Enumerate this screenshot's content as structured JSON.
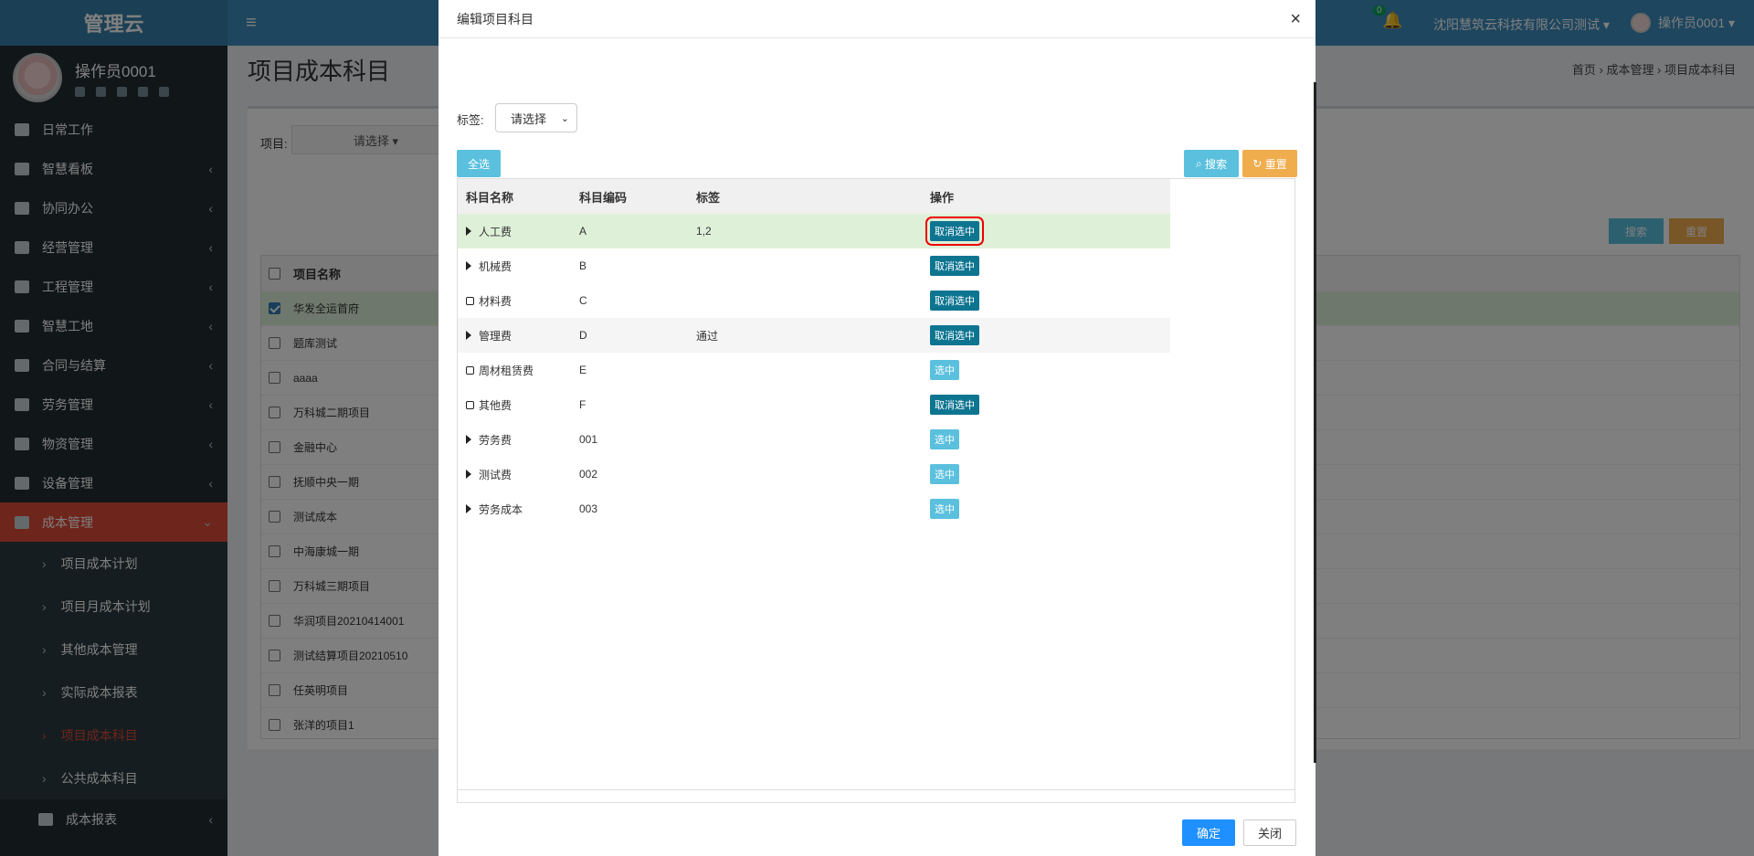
{
  "app": {
    "brand": "管理云"
  },
  "sidebar": {
    "user_name": "操作员0001",
    "menu": [
      {
        "label": "日常工作",
        "icon": "list-icon",
        "chevron": ""
      },
      {
        "label": "智慧看板",
        "icon": "dashboard-icon",
        "chevron": "‹"
      },
      {
        "label": "协同办公",
        "icon": "users-icon",
        "chevron": "‹"
      },
      {
        "label": "经营管理",
        "icon": "desktop-icon",
        "chevron": "‹"
      },
      {
        "label": "工程管理",
        "icon": "gavel-icon",
        "chevron": "‹"
      },
      {
        "label": "智慧工地",
        "icon": "monitor-icon",
        "chevron": "‹"
      },
      {
        "label": "合同与结算",
        "icon": "file-icon",
        "chevron": "‹"
      },
      {
        "label": "劳务管理",
        "icon": "worker-icon",
        "chevron": "‹"
      },
      {
        "label": "物资管理",
        "icon": "box-icon",
        "chevron": "‹"
      },
      {
        "label": "设备管理",
        "icon": "cubes-icon",
        "chevron": "‹"
      },
      {
        "label": "成本管理",
        "icon": "list-icon",
        "chevron": "⌄"
      }
    ],
    "submenu": [
      {
        "label": "项目成本计划"
      },
      {
        "label": "项目月成本计划"
      },
      {
        "label": "其他成本管理"
      },
      {
        "label": "实际成本报表"
      },
      {
        "label": "项目成本科目"
      },
      {
        "label": "公共成本科目"
      }
    ],
    "last_item": {
      "label": "成本报表",
      "chevron": "‹"
    }
  },
  "topbar": {
    "notification_count": "0",
    "company": "沈阳慧筑云科技有限公司测试 ▾",
    "user": "操作员0001 ▾"
  },
  "content": {
    "page_title": "项目成本科目",
    "breadcrumb": "首页 › 成本管理 › 项目成本科目",
    "project_label": "项目:",
    "project_select": "请选择 ▾",
    "search_label": "搜索",
    "reset_label": "重置",
    "table_header": "项目名称",
    "projects": [
      "华发全运首府",
      "题库测试",
      "aaaa",
      "万科城二期项目",
      "金融中心",
      "抚顺中央一期",
      "测试成本",
      "中海康城一期",
      "万科城三期项目",
      "华润项目20210414001",
      "测试结算项目20210510",
      "任英明项目",
      "张洋的项目1"
    ]
  },
  "modal": {
    "title": "编辑项目科目",
    "close_glyph": "×",
    "tag_label": "标签:",
    "tag_select": "请选择",
    "select_all": "全选",
    "search": "搜索",
    "reset": "重置",
    "columns": [
      "科目名称",
      "科目编码",
      "标签",
      "操作"
    ],
    "rows": [
      {
        "name": "人工费",
        "code": "A",
        "tag": "1,2",
        "action": "取消选中"
      },
      {
        "name": "机械费",
        "code": "B",
        "tag": "",
        "action": "取消选中"
      },
      {
        "name": "材料费",
        "code": "C",
        "tag": "",
        "action": "取消选中"
      },
      {
        "name": "管理费",
        "code": "D",
        "tag": "通过",
        "action": "取消选中"
      },
      {
        "name": "周材租赁费",
        "code": "E",
        "tag": "",
        "action": "选中"
      },
      {
        "name": "其他费",
        "code": "F",
        "tag": "",
        "action": "取消选中"
      },
      {
        "name": "劳务费",
        "code": "001",
        "tag": "",
        "action": "选中"
      },
      {
        "name": "测试费",
        "code": "002",
        "tag": "",
        "action": "选中"
      },
      {
        "name": "劳务成本",
        "code": "003",
        "tag": "",
        "action": "选中"
      }
    ],
    "ok": "确定",
    "close": "关闭"
  }
}
